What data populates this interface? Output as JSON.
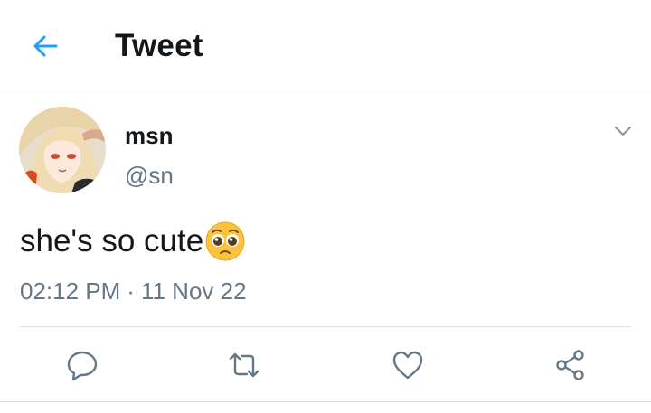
{
  "header": {
    "back_icon": "arrow-left-icon",
    "title": "Tweet",
    "accent_color": "#1da1f2"
  },
  "tweet": {
    "author_name": "msn",
    "author_handle": "@sn",
    "text": "she's so cute",
    "emoji": "pleading-face",
    "time": "02:12 PM",
    "separator": "·",
    "date": "11 Nov 22"
  },
  "actions": {
    "reply_icon": "reply-icon",
    "retweet_icon": "retweet-icon",
    "like_icon": "heart-icon",
    "share_icon": "share-icon",
    "icon_color": "#657786"
  }
}
